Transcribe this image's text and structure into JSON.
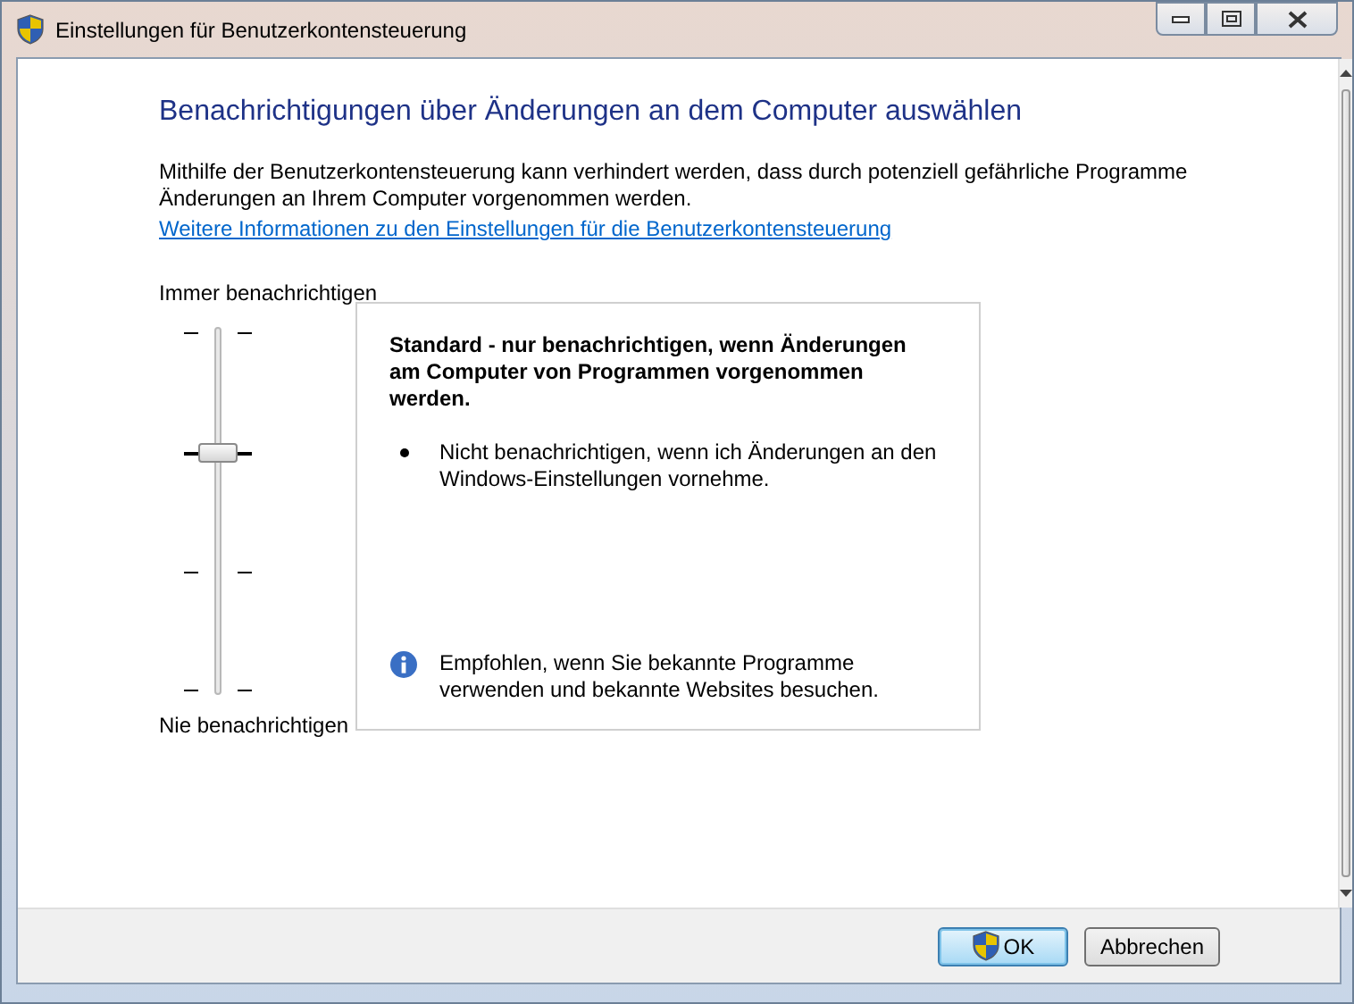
{
  "window": {
    "title": "Einstellungen für Benutzerkontensteuerung"
  },
  "heading": "Benachrichtigungen über Änderungen an dem Computer auswählen",
  "description": "Mithilfe der Benutzerkontensteuerung kann verhindert werden, dass durch potenziell gefährliche Programme Änderungen an Ihrem Computer vorgenommen werden.",
  "info_link": "Weitere Informationen zu den Einstellungen für die Benutzerkontensteuerung",
  "slider": {
    "top_label": "Immer benachrichtigen",
    "bottom_label": "Nie benachrichtigen",
    "level": 0.667
  },
  "panel": {
    "title": "Standard - nur benachrichtigen, wenn Änderungen am Computer von Programmen vorgenommen werden.",
    "bullets": [
      "Nicht benachrichtigen, wenn ich Änderungen an den Windows-Einstellungen vornehme."
    ],
    "recommendation": "Empfohlen, wenn Sie bekannte Programme verwenden und bekannte Websites besuchen."
  },
  "buttons": [
    {
      "label": "OK",
      "kind": "primary",
      "shield": true
    },
    {
      "label": "Abbrechen",
      "kind": "secondary",
      "shield": false
    }
  ]
}
